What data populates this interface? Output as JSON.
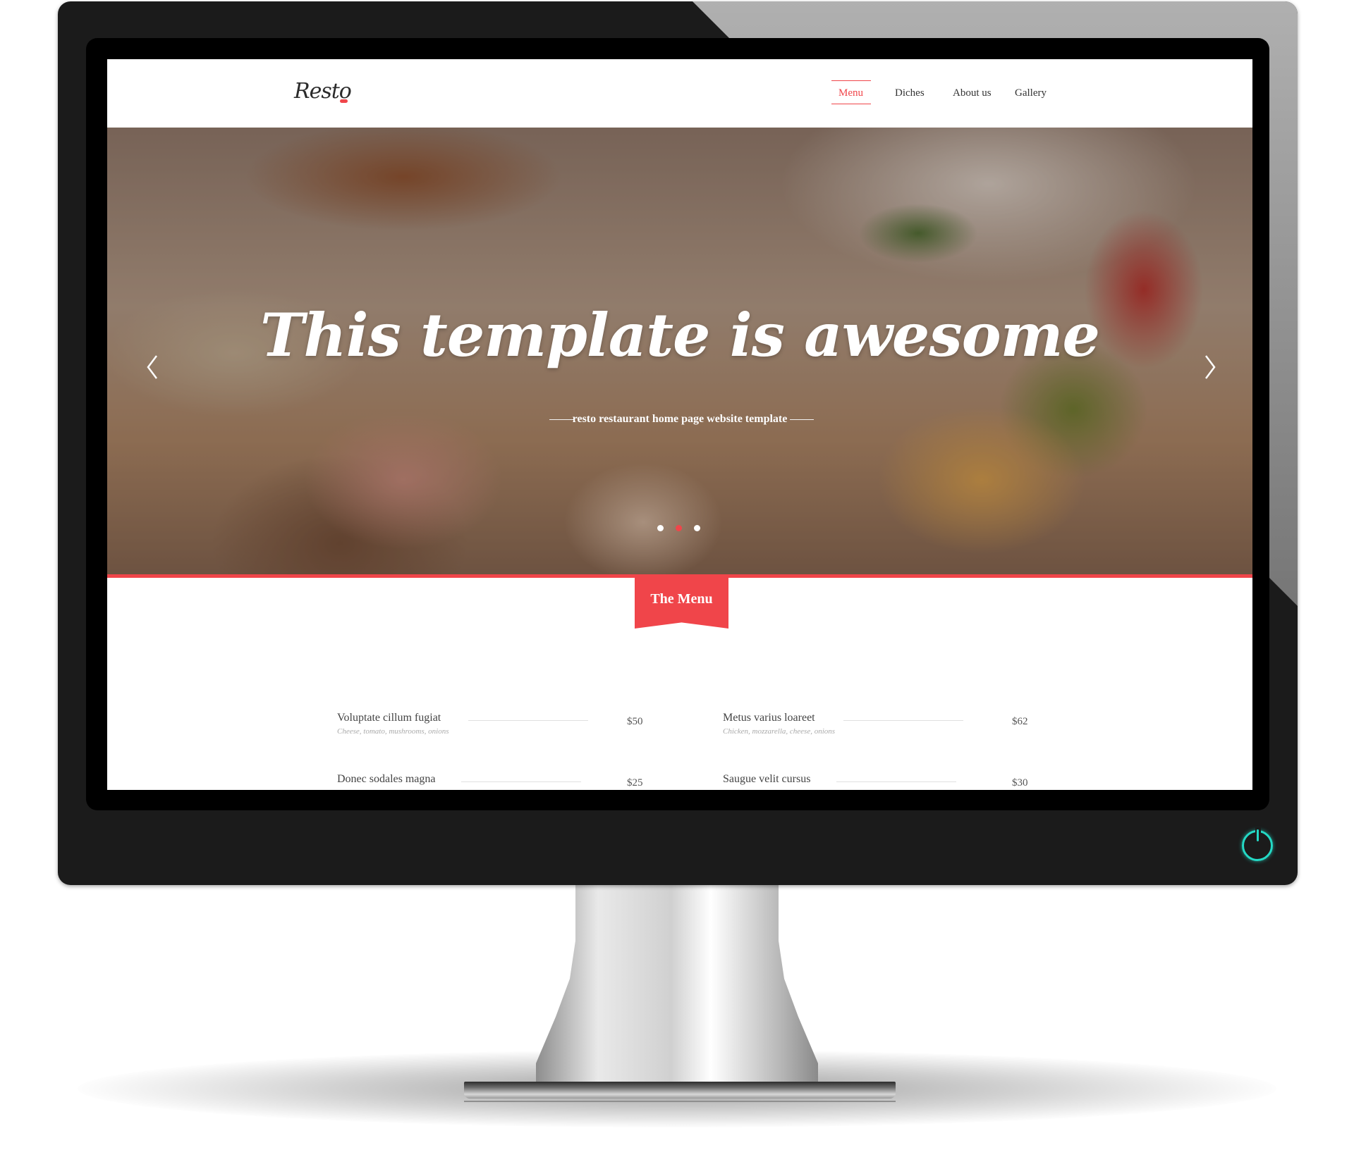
{
  "site": {
    "logo": "Resto",
    "nav": [
      {
        "label": "Menu",
        "active": true
      },
      {
        "label": "Diches",
        "active": false
      },
      {
        "label": "About us",
        "active": false
      },
      {
        "label": "Gallery",
        "active": false
      }
    ]
  },
  "hero": {
    "title": "This template is awesome",
    "subtitle": "resto restaurant home page website template",
    "slides": 3,
    "active_slide": 2
  },
  "menu_section": {
    "title": "The Menu",
    "items": [
      {
        "name": "Voluptate cillum fugiat",
        "desc": "Cheese, tomato, mushrooms, onions",
        "price": "$50"
      },
      {
        "name": "Metus varius loareet",
        "desc": "Chicken, mozzarella, cheese, onions",
        "price": "$62"
      },
      {
        "name": "Donec sodales magna",
        "desc": "",
        "price": "$25"
      },
      {
        "name": "Saugue velit cursus",
        "desc": "",
        "price": "$30"
      }
    ]
  },
  "colors": {
    "accent": "#f0454a",
    "power_led": "#24d9c5",
    "bezel": "#1b1b1b"
  },
  "icons": {
    "prev": "chevron-left-icon",
    "next": "chevron-right-icon",
    "power": "power-icon"
  }
}
